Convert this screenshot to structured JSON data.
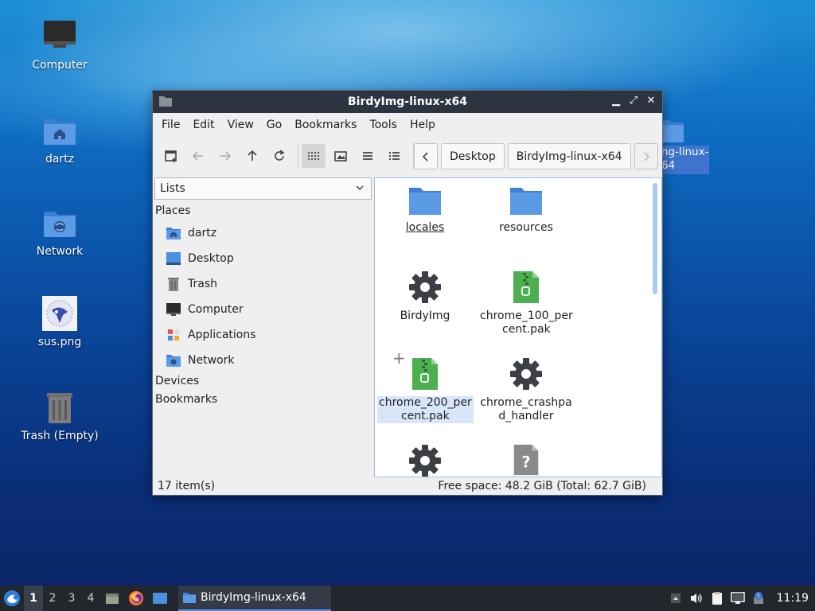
{
  "desktop": {
    "icons": [
      {
        "label": "Computer",
        "icon": "monitor-icon"
      },
      {
        "label": "dartz",
        "icon": "home-folder-icon"
      },
      {
        "label": "Network",
        "icon": "network-folder-icon"
      },
      {
        "label": "sus.png",
        "icon": "image-file-icon"
      },
      {
        "label": "Trash (Empty)",
        "icon": "trash-icon"
      }
    ],
    "stray_label_line1": "ng-linux-",
    "stray_label_line2": "64"
  },
  "window": {
    "title": "BirdyImg-linux-x64",
    "controls": {
      "minimize": "▁",
      "maximize": "⤢",
      "close": "✕"
    },
    "menu": [
      "File",
      "Edit",
      "View",
      "Go",
      "Bookmarks",
      "Tools",
      "Help"
    ],
    "breadcrumbs": [
      "Desktop",
      "BirdyImg-linux-x64"
    ],
    "sidebar": {
      "selector": "Lists",
      "places_heading": "Places",
      "places": [
        {
          "label": "dartz",
          "icon": "home-folder-icon"
        },
        {
          "label": "Desktop",
          "icon": "desktop-icon"
        },
        {
          "label": "Trash",
          "icon": "trash-icon"
        },
        {
          "label": "Computer",
          "icon": "monitor-icon"
        },
        {
          "label": "Applications",
          "icon": "applications-icon"
        },
        {
          "label": "Network",
          "icon": "network-folder-icon"
        }
      ],
      "devices_heading": "Devices",
      "bookmarks_heading": "Bookmarks"
    },
    "files": [
      {
        "label": "locales",
        "type": "folder"
      },
      {
        "label": "resources",
        "type": "folder"
      },
      {
        "label": "BirdyImg",
        "type": "executable"
      },
      {
        "label_line1": "chrome_100_per",
        "label_line2": "cent.pak",
        "type": "archive"
      },
      {
        "label_line1": "chrome_200_per",
        "label_line2": "cent.pak",
        "type": "archive",
        "selected": true
      },
      {
        "label_line1": "chrome_crashpa",
        "label_line2": "d_handler",
        "type": "executable"
      },
      {
        "label": "",
        "type": "executable"
      },
      {
        "label": "",
        "type": "unknown"
      }
    ],
    "status": {
      "items": "17 item(s)",
      "space": "Free space: 48.2 GiB (Total: 62.7 GiB)"
    }
  },
  "taskbar": {
    "workspaces": [
      "1",
      "2",
      "3",
      "4"
    ],
    "active_workspace": "1",
    "task_title": "BirdyImg-linux-x64",
    "clock": "11:19"
  },
  "colors": {
    "folder_blue": "#4a8fe0",
    "archive_green": "#4caf50",
    "gear_dark": "#3c4046",
    "titlebar": "#2c3440",
    "selection": "#d9e6fa"
  }
}
